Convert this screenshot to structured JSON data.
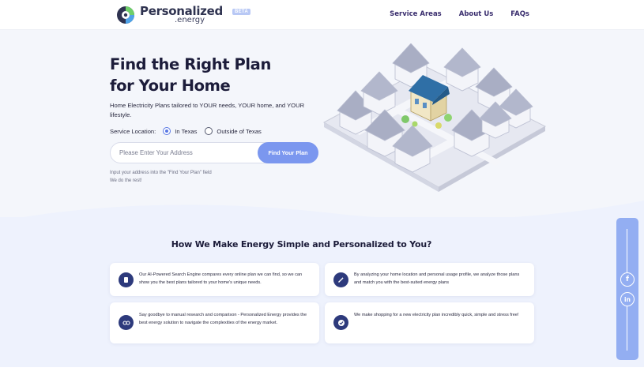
{
  "header": {
    "logo_name": "Personalized",
    "logo_sub": ".energy",
    "beta": "BETA",
    "nav": [
      "Service Areas",
      "About Us",
      "FAQs"
    ]
  },
  "hero": {
    "title_line1": "Find the Right Plan",
    "title_line2": "for Your Home",
    "subtitle": "Home Electricity Plans tailored to YOUR needs, YOUR home, and YOUR lifestyle.",
    "service_location_label": "Service Location:",
    "option_in": "In Texas",
    "option_out": "Outside of Texas",
    "selected": "In Texas",
    "address_placeholder": "Please Enter Your Address",
    "address_value": "",
    "find_button": "Find Your Plan",
    "hint_line1": "Input your address into the \"Find Your Plan\" field",
    "hint_line2": "We do the rest!"
  },
  "features": {
    "title": "How We Make Energy Simple and Personalized to You?",
    "cards": [
      {
        "icon": "chip-icon",
        "text": "Our AI-Powered Search Engine compares every online plan we can find, so we can show you the best plans tailored to your home's unique needs."
      },
      {
        "icon": "wand-icon",
        "text": "By analyzing your home location and personal usage profile, we analyze those plans and match you with the best-suited energy plans"
      },
      {
        "icon": "glasses-icon",
        "text": "Say goodbye to manual research and comparison - Personalized Energy provides the best energy solution to navigate the complexities of the energy market."
      },
      {
        "icon": "check-badge-icon",
        "text": "We make shopping for a new electricity plan incredibly quick, simple and stress free!"
      }
    ]
  },
  "social": {
    "facebook": "f",
    "linkedin": "in"
  },
  "colors": {
    "accent": "#7b97ef",
    "navy": "#2d3a7c",
    "hero_bg": "#f4f6fb",
    "features_bg": "#eef2fd",
    "social_bar": "#93aef2"
  }
}
